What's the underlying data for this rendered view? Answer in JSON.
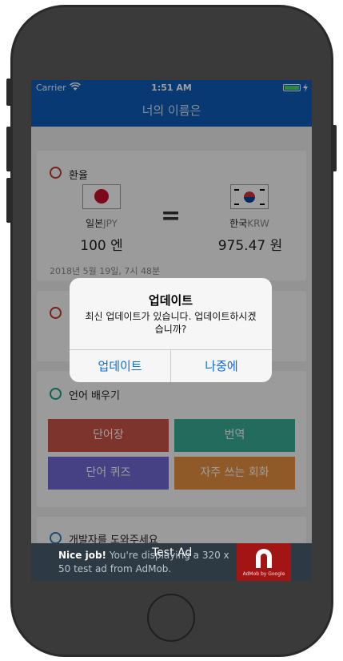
{
  "status_bar": {
    "carrier": "Carrier",
    "time": "1:51 AM"
  },
  "nav": {
    "title": "너의 이름은"
  },
  "exchange": {
    "section_title": "환율",
    "from": {
      "name": "일본",
      "code": "JPY",
      "amount": "100 엔"
    },
    "operator": "=",
    "to": {
      "name": "한국",
      "code": "KRW",
      "amount": "975.47 원"
    },
    "timestamp": "2018년 5월 19일, 7시 48분"
  },
  "learn": {
    "section_title": "언어 배우기",
    "buttons": [
      "단어장",
      "번역",
      "단어 퀴즈",
      "자주 쓰는 회화"
    ]
  },
  "help": {
    "section_title": "개발자를 도와주세요"
  },
  "alert": {
    "title": "업데이트",
    "message": "최신 업데이트가 있습니다. 업데이트하시겠습니까?",
    "update_button": "업데이트",
    "later_button": "나중에"
  },
  "ad": {
    "label": "Test Ad",
    "nice_job": "Nice job!",
    "body": "You're displaying a 320 x 50 test ad from AdMob.",
    "badge": "AdMob by Google"
  },
  "colors": {
    "nav": "#0d5db8",
    "radio_exchange": "#c0392b",
    "radio_learn": "#16a085",
    "radio_help": "#2980b9",
    "btn_words": "#c0392b",
    "btn_translate": "#16a085",
    "btn_quiz": "#5b4fd1",
    "btn_phrases": "#e67e22",
    "alert_button": "#0a6be0"
  }
}
